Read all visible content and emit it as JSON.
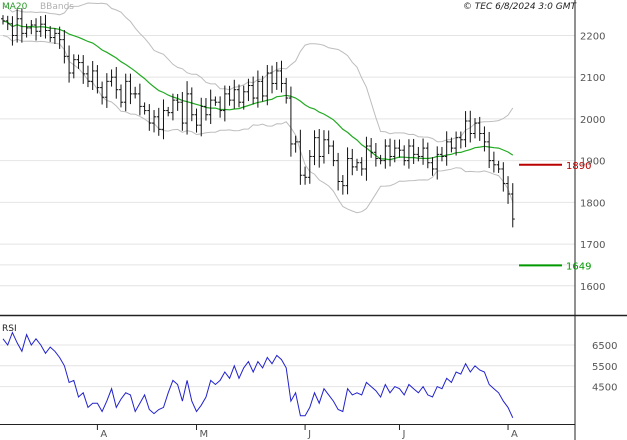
{
  "chart_data": [
    {
      "type": "ohlc",
      "indicators": {
        "ma": {
          "label": "MA20",
          "color": "#22aa22"
        },
        "bbands": {
          "label": "BBands",
          "color": "#bdbdbd"
        }
      },
      "copyright": "© TEC 6/8/2024 3:0 GMT",
      "y_ticks": [
        {
          "value": 2200,
          "label": "2200"
        },
        {
          "value": 2100,
          "label": "2100"
        },
        {
          "value": 2000,
          "label": "2000"
        },
        {
          "value": 1900,
          "label": "1900"
        },
        {
          "value": 1800,
          "label": "1800"
        },
        {
          "value": 1700,
          "label": "1700"
        },
        {
          "value": 1600,
          "label": "1600"
        }
      ],
      "ylim": [
        1530,
        2285
      ],
      "x_ticks": [
        {
          "index": 20,
          "label": "A"
        },
        {
          "index": 41,
          "label": "M"
        },
        {
          "index": 64,
          "label": "J"
        },
        {
          "index": 84,
          "label": "J"
        },
        {
          "index": 107,
          "label": "A"
        }
      ],
      "levels": [
        {
          "value": 1890,
          "label": "1890",
          "color": "#bb0000"
        },
        {
          "value": 1649,
          "label": "1649",
          "color": "#009900"
        }
      ],
      "closes": [
        2235,
        2228,
        2200,
        2240,
        2205,
        2218,
        2225,
        2210,
        2227,
        2212,
        2195,
        2205,
        2190,
        2150,
        2110,
        2142,
        2135,
        2108,
        2090,
        2115,
        2075,
        2052,
        2090,
        2100,
        2070,
        2040,
        2090,
        2060,
        2060,
        2030,
        2020,
        1990,
        2005,
        1975,
        2020,
        2015,
        2045,
        2040,
        1990,
        2060,
        2010,
        1985,
        2030,
        2010,
        2045,
        2040,
        2020,
        2060,
        2045,
        2070,
        2040,
        2065,
        2080,
        2050,
        2090,
        2055,
        2110,
        2085,
        2115,
        2085,
        2050,
        1940,
        1945,
        1865,
        1860,
        1910,
        1955,
        1910,
        1950,
        1935,
        1900,
        1850,
        1840,
        1905,
        1885,
        1895,
        1880,
        1935,
        1920,
        1905,
        1900,
        1935,
        1910,
        1930,
        1925,
        1900,
        1935,
        1915,
        1910,
        1930,
        1895,
        1880,
        1915,
        1910,
        1945,
        1930,
        1955,
        1950,
        1995,
        1965,
        1990,
        1965,
        1945,
        1900,
        1890,
        1880,
        1845,
        1820,
        1760
      ]
    },
    {
      "type": "line",
      "title": "RSI",
      "color": "#2222cc",
      "y_ticks": [
        {
          "value": 65,
          "label": "6500"
        },
        {
          "value": 55,
          "label": "5500"
        },
        {
          "value": 45,
          "label": "4500"
        }
      ],
      "ylim": [
        27,
        78
      ],
      "values": [
        68,
        65,
        71,
        66,
        62,
        70,
        65,
        68,
        65,
        61,
        64,
        62,
        59,
        55,
        47,
        48,
        40,
        42,
        35,
        37,
        37,
        33,
        38,
        44,
        35,
        39,
        42,
        41,
        33,
        37,
        41,
        34,
        32,
        34,
        35,
        42,
        48,
        46,
        38,
        48,
        38,
        33,
        36,
        40,
        48,
        46,
        48,
        52,
        49,
        55,
        49,
        54,
        57,
        52,
        57,
        54,
        59,
        56,
        60,
        58,
        54,
        38,
        42,
        31,
        31,
        35,
        42,
        37,
        44,
        41,
        38,
        34,
        33,
        44,
        41,
        42,
        41,
        47,
        45,
        43,
        40,
        46,
        42,
        45,
        44,
        41,
        46,
        44,
        42,
        45,
        41,
        40,
        45,
        44,
        49,
        47,
        52,
        51,
        56,
        52,
        55,
        53,
        52,
        46,
        44,
        42,
        38,
        35,
        30
      ]
    }
  ]
}
